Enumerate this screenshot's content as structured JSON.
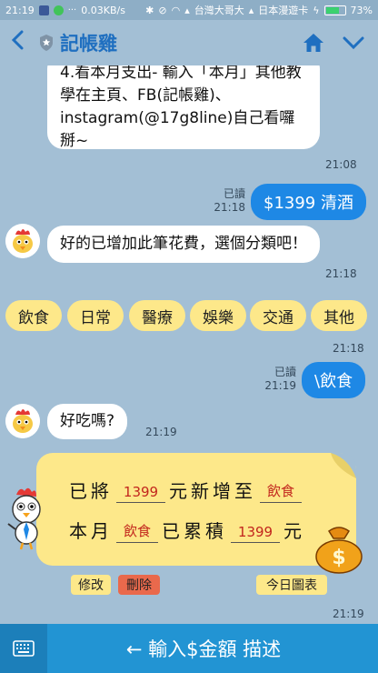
{
  "status_bar": {
    "time": "21:19",
    "speed": "0.03KB/s",
    "carrier1": "台灣大哥大",
    "carrier2": "日本漫遊卡",
    "battery": "73%",
    "battery_level": 0.73
  },
  "header": {
    "title": "記帳雞"
  },
  "messages": {
    "intro_text": "4.看本月支出- 輸入「本月」其他教學在主頁、FB(記帳雞)、instagram(@17g8line)自己看囉掰~",
    "intro_time": "21:08",
    "user1_read": "已讀",
    "user1_time": "21:18",
    "user1_text": "$1399 清酒",
    "bot1_text": "好的已增加此筆花費，選個分類吧！",
    "bot1_time": "21:18",
    "chips_time": "21:18",
    "user2_read": "已讀",
    "user2_time": "21:19",
    "user2_text": "\\飲食",
    "bot2_text": "好吃嗎?",
    "bot2_time": "21:19",
    "card_time": "21:19"
  },
  "category_chips": [
    "飲食",
    "日常",
    "醫療",
    "娛樂",
    "交通",
    "其他"
  ],
  "card": {
    "row1_a": "已將",
    "row1_amount": "1399",
    "row1_b": "元新增至",
    "row1_cat": "飲食",
    "row2_a": "本月",
    "row2_cat": "飲食",
    "row2_b": "已累積",
    "row2_amount": "1399",
    "row2_c": "元"
  },
  "card_buttons": {
    "edit": "修改",
    "delete": "刪除",
    "chart": "今日圖表"
  },
  "bottom_bar": {
    "label": "← 輸入$金額 描述"
  }
}
